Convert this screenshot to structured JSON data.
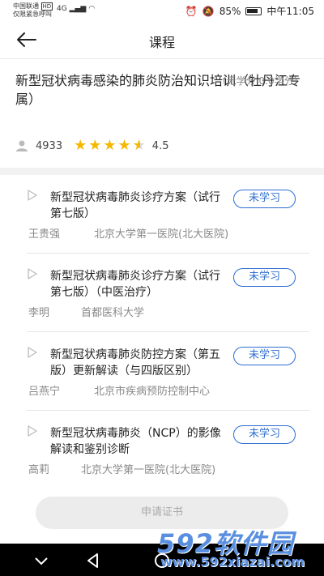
{
  "status_bar": {
    "carrier": "中国联通",
    "carrier_tag": "HD",
    "emergency": "仅限紧急呼叫",
    "network": "4G",
    "battery": "85%",
    "time": "中午11:05"
  },
  "header": {
    "title": "课程"
  },
  "course": {
    "title": "新型冠状病毒感染的肺炎防治知识培训（牡丹江专属）",
    "credit": "(无学分 0.0学分)",
    "learners": "4933",
    "rating": "4.5",
    "rating_value": 4.5
  },
  "lessons": [
    {
      "title": "新型冠状病毒肺炎诊疗方案（试行第七版）",
      "status": "未学习",
      "lecturer": "王贵强",
      "hospital": "北京大学第一医院(北大医院)"
    },
    {
      "title": "新型冠状病毒肺炎诊疗方案（试行第七版）（中医治疗）",
      "status": "未学习",
      "lecturer": "李明",
      "hospital": "首都医科大学"
    },
    {
      "title": "新型冠状病毒肺炎防控方案（第五版）更新解读（与四版区别）",
      "status": "未学习",
      "lecturer": "吕燕宁",
      "hospital": "北京市疾病预防控制中心"
    },
    {
      "title": "新型冠状病毒肺炎（NCP）的影像解读和鉴别诊断",
      "status": "未学习",
      "lecturer": "高莉",
      "hospital": "北京大学第一医院(北大医院)"
    }
  ],
  "apply_button": "申请证书",
  "watermark": {
    "main": "592软件园",
    "url": "www.592xiazai.com"
  },
  "colors": {
    "accent": "#2e6fd0",
    "star": "#f5b800"
  }
}
